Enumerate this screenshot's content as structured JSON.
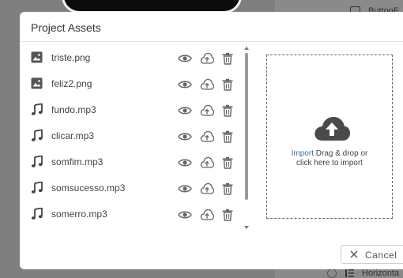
{
  "background": {
    "button_label": "ButtonE",
    "horizontal_label": "Horizonta"
  },
  "dialog": {
    "title": "Project Assets",
    "files": [
      {
        "name": "triste.png",
        "type": "image-icon"
      },
      {
        "name": "feliz2.png",
        "type": "image-icon"
      },
      {
        "name": "fundo.mp3",
        "type": "music-note-icon"
      },
      {
        "name": "clicar.mp3",
        "type": "music-note-icon"
      },
      {
        "name": "somfim.mp3",
        "type": "music-note-icon"
      },
      {
        "name": "somsucesso.mp3",
        "type": "music-note-icon"
      },
      {
        "name": "somerro.mp3",
        "type": "music-note-icon"
      }
    ],
    "dropzone": {
      "import_link": "Import",
      "text_line1": " Drag & drop or",
      "text_line2": "click here to import"
    },
    "cancel_label": "Cancel"
  }
}
